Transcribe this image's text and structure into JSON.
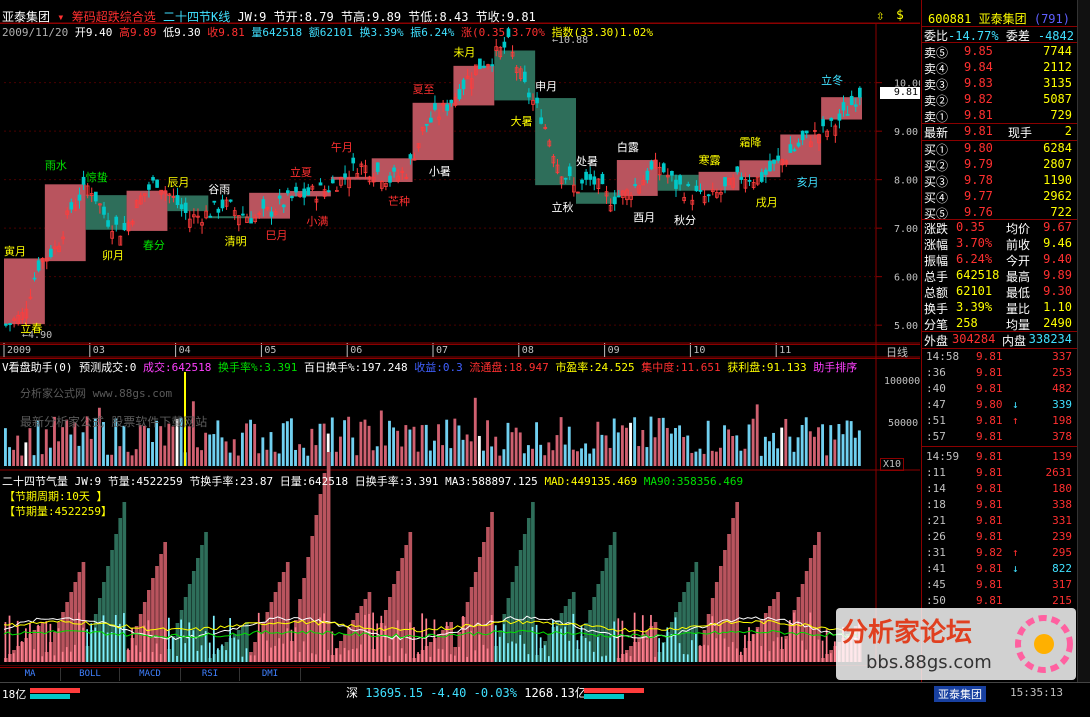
{
  "header": {
    "stock_name": "亚泰集团",
    "indicator_name": "筹码超跌综合选",
    "overlay_name": "二十四节K线",
    "jw": "JW:9",
    "jie_kai": "节开:8.79",
    "jie_gao": "节高:9.89",
    "jie_di": "节低:8.43",
    "jie_shou": "节收:9.81",
    "date": "2009/11/20",
    "open": "开9.40",
    "high": "高9.89",
    "low": "低9.30",
    "close": "收9.81",
    "volume": "量642518",
    "amount": "额62101",
    "turnover": "换3.39%",
    "amplitude": "振6.24%",
    "change": "涨(0.35)3.70%",
    "index": "指数(33.30)1.02%"
  },
  "price_axis": [
    "10.00",
    "9.00",
    "8.00",
    "7.00",
    "6.00",
    "5.00"
  ],
  "current_price_tag": "9.81",
  "max_label": "10.88",
  "min_label": "4.90",
  "month_labels": [
    "2009",
    "03",
    "04",
    "05",
    "06",
    "07",
    "08",
    "09",
    "10",
    "11"
  ],
  "period_label": "日线",
  "solar_terms": [
    {
      "t": "寅月",
      "c": "yel"
    },
    {
      "t": "立春",
      "c": "yel"
    },
    {
      "t": "雨水",
      "c": "grn"
    },
    {
      "t": "卯月",
      "c": "yel"
    },
    {
      "t": "惊蛰",
      "c": "grn"
    },
    {
      "t": "春分",
      "c": "grn"
    },
    {
      "t": "辰月",
      "c": "yel"
    },
    {
      "t": "清明",
      "c": "yel"
    },
    {
      "t": "谷雨",
      "c": "wht"
    },
    {
      "t": "巳月",
      "c": "red"
    },
    {
      "t": "立夏",
      "c": "red"
    },
    {
      "t": "小满",
      "c": "red"
    },
    {
      "t": "午月",
      "c": "red"
    },
    {
      "t": "芒种",
      "c": "red"
    },
    {
      "t": "夏至",
      "c": "red"
    },
    {
      "t": "小暑",
      "c": "wht"
    },
    {
      "t": "未月",
      "c": "yel"
    },
    {
      "t": "大暑",
      "c": "yel"
    },
    {
      "t": "申月",
      "c": "wht"
    },
    {
      "t": "立秋",
      "c": "wht"
    },
    {
      "t": "处暑",
      "c": "wht"
    },
    {
      "t": "酉月",
      "c": "wht"
    },
    {
      "t": "白露",
      "c": "wht"
    },
    {
      "t": "秋分",
      "c": "wht"
    },
    {
      "t": "寒露",
      "c": "yel"
    },
    {
      "t": "戌月",
      "c": "yel"
    },
    {
      "t": "霜降",
      "c": "yel"
    },
    {
      "t": "亥月",
      "c": "cyn"
    },
    {
      "t": "立冬",
      "c": "cyn"
    }
  ],
  "panel2": {
    "title": "V看盘助手(0)",
    "items": [
      "预测成交:0",
      "成交:642518",
      "换手率%:3.391",
      "百日换手%:197.248",
      "收益:0.3",
      "流通盘:18.947",
      "市盈率:24.525",
      "集中度:11.651",
      "获利盘:91.133",
      "助手排序"
    ],
    "axis": [
      "100000",
      "50000"
    ],
    "scale": "X10",
    "watermark": [
      "分析家公式网 www.88gs.com",
      "最新分析家公式 股票软件下载网站"
    ]
  },
  "panel3": {
    "title": "二十四节气量",
    "items": [
      "JW:9",
      "节量:4522259",
      "节换手率:23.87",
      "日量:642518",
      "日换手率:3.391",
      "MA3:588897.125",
      "MAD:449135.469",
      "MA90:358356.469"
    ],
    "box1": "【节期周期:10天 】",
    "box2": "【节期量:4522259】"
  },
  "tabs": [
    "MA",
    "BOLL",
    "MACD",
    "RSI",
    "DMI"
  ],
  "status_bar": {
    "left": "18亿",
    "market": "深",
    "index_value": "13695.15",
    "index_change": "-4.40",
    "index_pct": "-0.03%",
    "amount": "1268.13亿",
    "stock": "亚泰集团",
    "time": "15:35:13"
  },
  "quote": {
    "code": "600881",
    "name": "亚泰集团",
    "code_suffix": "(791)",
    "weibi_label": "委比",
    "weibi": "-14.77%",
    "weicha_label": "委差",
    "weicha": "-4842",
    "asks": [
      {
        "label": "卖⑤",
        "price": "9.85",
        "vol": "7744"
      },
      {
        "label": "卖④",
        "price": "9.84",
        "vol": "2112"
      },
      {
        "label": "卖③",
        "price": "9.83",
        "vol": "3135"
      },
      {
        "label": "卖②",
        "price": "9.82",
        "vol": "5087"
      },
      {
        "label": "卖①",
        "price": "9.81",
        "vol": "729"
      }
    ],
    "latest_label": "最新",
    "latest": "9.81",
    "xianshou_label": "现手",
    "xianshou": "2",
    "bids": [
      {
        "label": "买①",
        "price": "9.80",
        "vol": "6284"
      },
      {
        "label": "买②",
        "price": "9.79",
        "vol": "2807"
      },
      {
        "label": "买③",
        "price": "9.78",
        "vol": "1190"
      },
      {
        "label": "买④",
        "price": "9.77",
        "vol": "2962"
      },
      {
        "label": "买⑤",
        "price": "9.76",
        "vol": "722"
      }
    ],
    "stats": [
      {
        "l1": "涨跌",
        "v1": "0.35",
        "l2": "均价",
        "v2": "9.67"
      },
      {
        "l1": "涨幅",
        "v1": "3.70%",
        "l2": "前收",
        "v2": "9.46"
      },
      {
        "l1": "振幅",
        "v1": "6.24%",
        "l2": "今开",
        "v2": "9.40"
      },
      {
        "l1": "总手",
        "v1": "642518",
        "l2": "最高",
        "v2": "9.89"
      },
      {
        "l1": "总额",
        "v1": "62101",
        "l2": "最低",
        "v2": "9.30"
      },
      {
        "l1": "换手",
        "v1": "3.39%",
        "l2": "量比",
        "v2": "1.10"
      },
      {
        "l1": "分笔",
        "v1": "258",
        "l2": "均量",
        "v2": "2490"
      }
    ],
    "waipan_label": "外盘",
    "waipan": "304284",
    "neipan_label": "内盘",
    "neipan": "338234"
  },
  "ticks": [
    {
      "time": "14:58",
      "price": "9.81",
      "arrow": "",
      "vol": "337"
    },
    {
      "time": ":36",
      "price": "9.81",
      "arrow": "",
      "vol": "253"
    },
    {
      "time": ":40",
      "price": "9.81",
      "arrow": "",
      "vol": "482"
    },
    {
      "time": ":47",
      "price": "9.80",
      "arrow": "↓",
      "vol": "339"
    },
    {
      "time": ":51",
      "price": "9.81",
      "arrow": "↑",
      "vol": "198"
    },
    {
      "time": ":57",
      "price": "9.81",
      "arrow": "",
      "vol": "378"
    },
    {
      "time": "14:59",
      "price": "9.81",
      "arrow": "",
      "vol": "139"
    },
    {
      "time": ":11",
      "price": "9.81",
      "arrow": "",
      "vol": "2631"
    },
    {
      "time": ":14",
      "price": "9.81",
      "arrow": "",
      "vol": "180"
    },
    {
      "time": ":18",
      "price": "9.81",
      "arrow": "",
      "vol": "338"
    },
    {
      "time": ":21",
      "price": "9.81",
      "arrow": "",
      "vol": "331"
    },
    {
      "time": ":26",
      "price": "9.81",
      "arrow": "",
      "vol": "239"
    },
    {
      "time": ":31",
      "price": "9.82",
      "arrow": "↑",
      "vol": "295"
    },
    {
      "time": ":41",
      "price": "9.81",
      "arrow": "↓",
      "vol": "822"
    },
    {
      "time": ":45",
      "price": "9.81",
      "arrow": "",
      "vol": "317"
    },
    {
      "time": ":50",
      "price": "9.81",
      "arrow": "",
      "vol": "215"
    }
  ],
  "forum_logo": {
    "title": "分析家论坛",
    "url": "bbs.88gs.com"
  },
  "chart_data": {
    "type": "candlestick",
    "ylim": [
      4.9,
      10.88
    ],
    "close_path": [
      5.0,
      5.2,
      6.3,
      6.6,
      7.5,
      7.9,
      7.2,
      6.9,
      7.6,
      8.0,
      7.6,
      7.2,
      7.3,
      7.5,
      7.3,
      7.2,
      7.4,
      7.6,
      7.7,
      7.8,
      8.0,
      8.3,
      8.2,
      8.0,
      8.2,
      9.1,
      9.4,
      9.8,
      10.3,
      10.5,
      10.8,
      9.9,
      9.3,
      8.3,
      7.8,
      8.0,
      7.6,
      7.7,
      8.0,
      8.3,
      7.9,
      7.7,
      7.6,
      7.8,
      8.1,
      8.0,
      8.3,
      8.6,
      8.9,
      9.0,
      9.3,
      9.81
    ],
    "solar_term_box_colors": [
      "#b9545e",
      "#2e6e5a"
    ],
    "sub_panels": [
      "volume",
      "solar-term volume"
    ],
    "colors": {
      "up": "#ff3c3c",
      "down": "#00c8c8",
      "term_up": "#b9545e",
      "term_down": "#2e6e5a",
      "grid": "#8b0000"
    }
  }
}
